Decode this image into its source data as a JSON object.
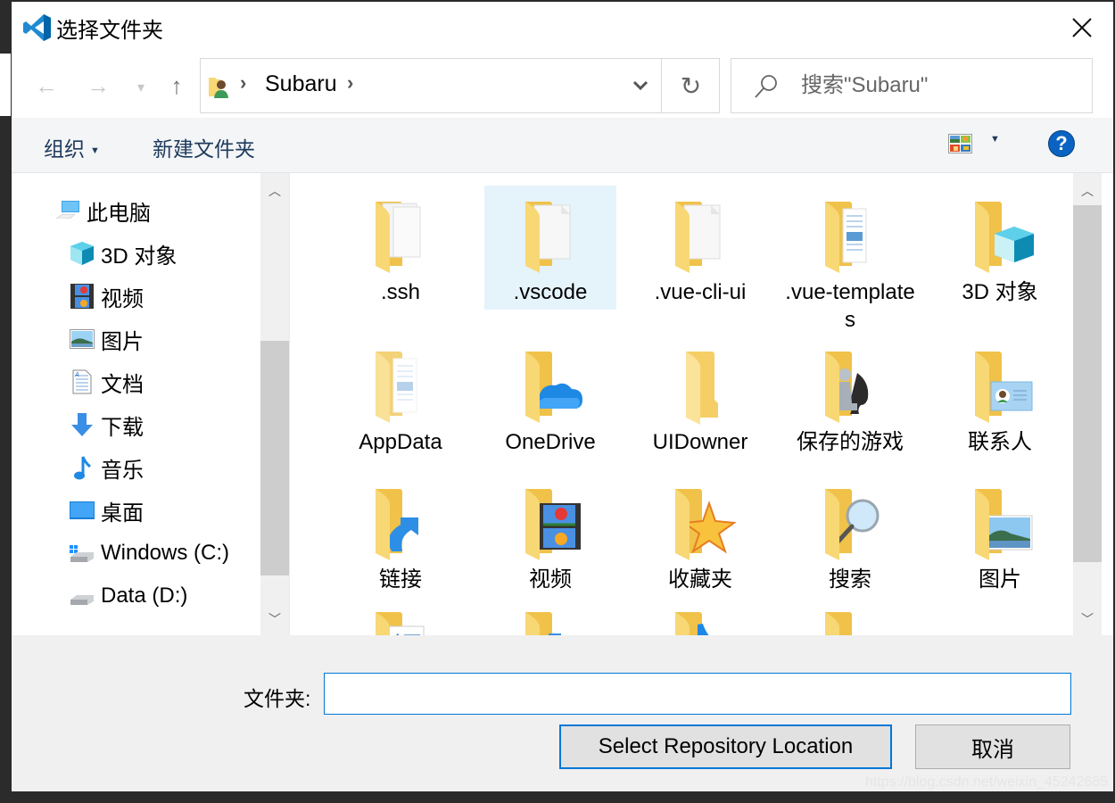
{
  "window": {
    "title": "选择文件夹",
    "close_label": "×"
  },
  "navigation": {
    "back_icon": "←",
    "forward_icon": "→",
    "recent_icon": "⌄",
    "up_icon": "↑",
    "breadcrumb": [
      "Subaru"
    ],
    "refresh_icon": "↻",
    "search_placeholder": "搜索\"Subaru\""
  },
  "toolbar": {
    "organize_label": "组织",
    "new_folder_label": "新建文件夹",
    "help_label": "?"
  },
  "sidebar": {
    "items": [
      {
        "label": "此电脑",
        "icon": "computer-icon"
      },
      {
        "label": "3D 对象",
        "icon": "3d-objects-icon"
      },
      {
        "label": "视频",
        "icon": "videos-icon"
      },
      {
        "label": "图片",
        "icon": "pictures-icon"
      },
      {
        "label": "文档",
        "icon": "documents-icon"
      },
      {
        "label": "下载",
        "icon": "downloads-icon"
      },
      {
        "label": "音乐",
        "icon": "music-icon"
      },
      {
        "label": "桌面",
        "icon": "desktop-icon"
      },
      {
        "label": "Windows (C:)",
        "icon": "drive-c-icon"
      },
      {
        "label": "Data (D:)",
        "icon": "drive-d-icon"
      }
    ]
  },
  "files": {
    "selected": ".vscode",
    "items": [
      {
        "label": ".ssh",
        "overlay": "documents"
      },
      {
        "label": ".vscode",
        "overlay": "document"
      },
      {
        "label": ".vue-cli-ui",
        "overlay": "document"
      },
      {
        "label": ".vue-templates",
        "overlay": "pages"
      },
      {
        "label": "3D 对象",
        "overlay": "cube"
      },
      {
        "label": "AppData",
        "overlay": "pages-light"
      },
      {
        "label": "OneDrive",
        "overlay": "cloud"
      },
      {
        "label": "UIDowner",
        "overlay": "none"
      },
      {
        "label": "保存的游戏",
        "overlay": "chess"
      },
      {
        "label": "联系人",
        "overlay": "contact-card"
      },
      {
        "label": "链接",
        "overlay": "link-arrow"
      },
      {
        "label": "视频",
        "overlay": "film"
      },
      {
        "label": "收藏夹",
        "overlay": "star"
      },
      {
        "label": "搜索",
        "overlay": "magnifier"
      },
      {
        "label": "图片",
        "overlay": "picture"
      },
      {
        "label": "",
        "overlay": "doc-text"
      },
      {
        "label": "",
        "overlay": "download"
      },
      {
        "label": "",
        "overlay": "music"
      },
      {
        "label": "",
        "overlay": "desktop"
      }
    ]
  },
  "footer": {
    "folder_label": "文件夹:",
    "folder_value": "",
    "select_button": "Select Repository Location",
    "cancel_button": "取消"
  },
  "colors": {
    "accent": "#0078d7",
    "selection": "#e5f3fb",
    "folder": "#f8d775",
    "toolbar_text": "#1e3a5c"
  }
}
